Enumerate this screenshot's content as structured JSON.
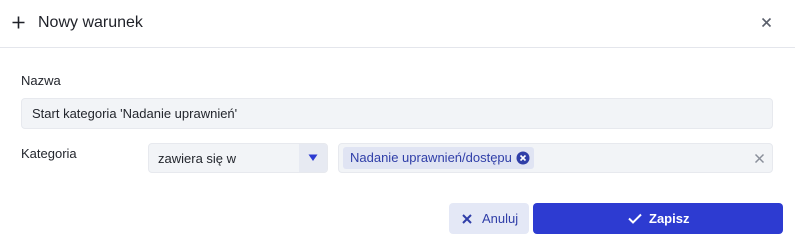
{
  "dialog": {
    "title": "Nowy warunek",
    "icon": "plus-icon",
    "close_icon": "close-icon"
  },
  "form": {
    "name": {
      "label": "Nazwa",
      "value": "Start kategoria 'Nadanie uprawnień'"
    },
    "category": {
      "label": "Kategoria",
      "operator": "zawiera się w",
      "tags": [
        "Nadanie uprawnień/dostępu"
      ]
    }
  },
  "buttons": {
    "cancel_label": "Anuluj",
    "save_label": "Zapisz"
  },
  "colors": {
    "accent": "#2d3bd1",
    "tag_text": "#2f3ea8",
    "tag_bg": "#e0e4f3"
  }
}
